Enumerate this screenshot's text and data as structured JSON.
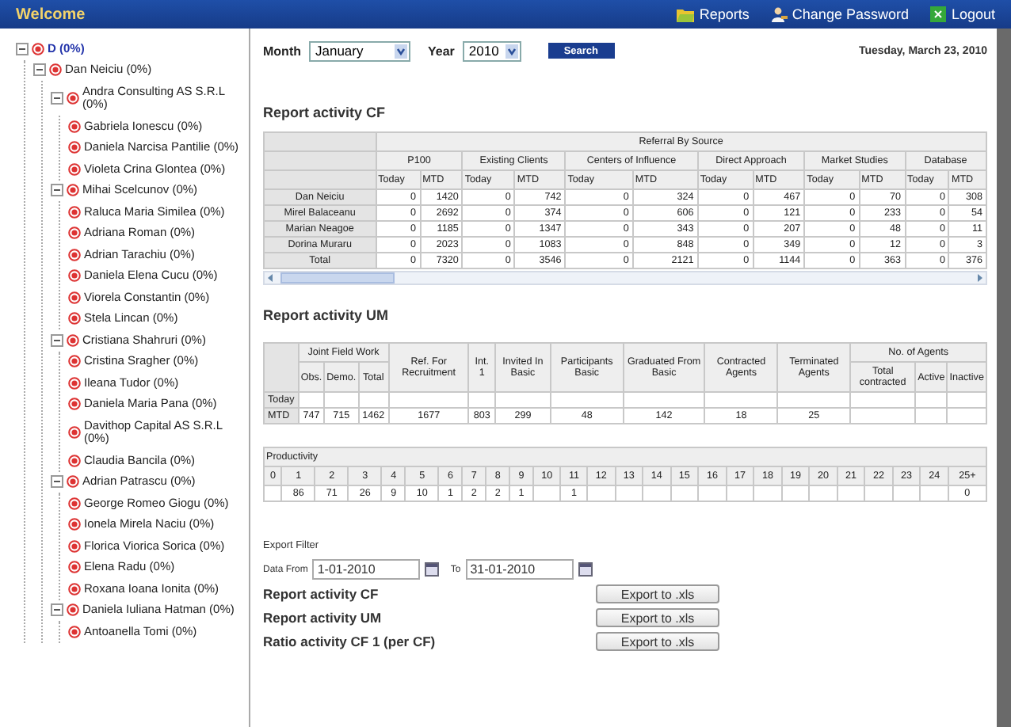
{
  "header": {
    "title": "Welcome",
    "links": [
      {
        "kind": "reports",
        "label": "Reports"
      },
      {
        "kind": "password",
        "label": "Change Password"
      },
      {
        "kind": "logout",
        "label": "Logout"
      }
    ]
  },
  "tree": [
    {
      "label": "D (0%)",
      "expanded": true,
      "children": [
        {
          "label": "Dan Neiciu (0%)",
          "expanded": true,
          "children": [
            {
              "label": "Andra Consulting AS S.R.L (0%)",
              "expanded": true,
              "children": [
                {
                  "label": "Gabriela Ionescu (0%)"
                },
                {
                  "label": "Daniela Narcisa Pantilie (0%)"
                },
                {
                  "label": "Violeta Crina Glontea (0%)"
                }
              ]
            },
            {
              "label": "Mihai Scelcunov (0%)",
              "expanded": true,
              "children": [
                {
                  "label": "Raluca Maria Similea (0%)"
                },
                {
                  "label": "Adriana Roman (0%)"
                },
                {
                  "label": "Adrian Tarachiu (0%)"
                },
                {
                  "label": "Daniela Elena Cucu (0%)"
                },
                {
                  "label": "Viorela Constantin (0%)"
                },
                {
                  "label": "Stela Lincan (0%)"
                }
              ]
            },
            {
              "label": "Cristiana Shahruri (0%)",
              "expanded": true,
              "children": [
                {
                  "label": "Cristina Sragher (0%)"
                },
                {
                  "label": "Ileana Tudor (0%)"
                },
                {
                  "label": "Daniela Maria Pana (0%)"
                },
                {
                  "label": "Davithop Capital AS S.R.L (0%)"
                },
                {
                  "label": "Claudia Bancila (0%)"
                }
              ]
            },
            {
              "label": "Adrian Patrascu (0%)",
              "expanded": true,
              "children": [
                {
                  "label": "George Romeo Giogu (0%)"
                },
                {
                  "label": "Ionela Mirela Naciu (0%)"
                },
                {
                  "label": "Florica Viorica Sorica (0%)"
                },
                {
                  "label": "Elena Radu (0%)"
                },
                {
                  "label": "Roxana Ioana Ionita (0%)"
                }
              ]
            },
            {
              "label": "Daniela Iuliana Hatman (0%)",
              "expanded": true,
              "children": [
                {
                  "label": "Antoanella Tomi (0%)"
                }
              ]
            }
          ]
        }
      ]
    }
  ],
  "filters": {
    "month_label": "Month",
    "month": "January",
    "year_label": "Year",
    "year": "2010",
    "search_button": "Search",
    "date": "Tuesday, March 23, 2010"
  },
  "report_cf": {
    "title": "Report activity CF",
    "group_header": "Referral By Source",
    "columns": [
      {
        "label": "P100",
        "sub_columns": [
          "Today",
          "MTD"
        ]
      },
      {
        "label": "Existing Clients",
        "sub_columns": [
          "Today",
          "MTD"
        ]
      },
      {
        "label": "Centers of Influence",
        "sub_columns": [
          "Today",
          "MTD"
        ]
      },
      {
        "label": "Direct Approach",
        "sub_columns": [
          "Today",
          "MTD"
        ]
      },
      {
        "label": "Market Studies",
        "sub_columns": [
          "Today",
          "MTD"
        ]
      },
      {
        "label": "Database",
        "sub_columns": [
          "Today",
          "MTD"
        ]
      }
    ],
    "rows": [
      {
        "label": "Dan Neiciu",
        "values": [
          "0",
          "1420",
          "0",
          "742",
          "0",
          "324",
          "0",
          "467",
          "0",
          "70",
          "0",
          "308"
        ]
      },
      {
        "label": "Mirel Balaceanu",
        "values": [
          "0",
          "2692",
          "0",
          "374",
          "0",
          "606",
          "0",
          "121",
          "0",
          "233",
          "0",
          "54"
        ]
      },
      {
        "label": "Marian Neagoe",
        "values": [
          "0",
          "1185",
          "0",
          "1347",
          "0",
          "343",
          "0",
          "207",
          "0",
          "48",
          "0",
          "11"
        ]
      },
      {
        "label": "Dorina Muraru",
        "values": [
          "0",
          "2023",
          "0",
          "1083",
          "0",
          "848",
          "0",
          "349",
          "0",
          "12",
          "0",
          "3"
        ]
      },
      {
        "label": "Total",
        "values": [
          "0",
          "7320",
          "0",
          "3546",
          "0",
          "2121",
          "0",
          "1144",
          "0",
          "363",
          "0",
          "376"
        ]
      }
    ]
  },
  "report_um": {
    "title": "Report activity UM",
    "columns": [
      {
        "label": "Joint Field Work",
        "children": [
          "Obs.",
          "Demo.",
          "Total"
        ]
      },
      {
        "label": "Ref. For Recruitment"
      },
      {
        "label": "Int. 1"
      },
      {
        "label": "Invited In Basic"
      },
      {
        "label": "Participants Basic"
      },
      {
        "label": "Graduated From Basic"
      },
      {
        "label": "Contracted Agents"
      },
      {
        "label": "Terminated Agents"
      },
      {
        "label": "No. of Agents",
        "children": [
          "Total contracted",
          "Active",
          "Inactive"
        ]
      }
    ],
    "rows": [
      {
        "label": "Today",
        "values": []
      },
      {
        "label": "MTD",
        "values": [
          "747",
          "715",
          "1462",
          "1677",
          "803",
          "299",
          "48",
          "142",
          "18",
          "25"
        ]
      }
    ]
  },
  "productivity": {
    "title": "Productivity",
    "columns": [
      "0",
      "1",
      "2",
      "3",
      "4",
      "5",
      "6",
      "7",
      "8",
      "9",
      "10",
      "11",
      "12",
      "13",
      "14",
      "15",
      "16",
      "17",
      "18",
      "19",
      "20",
      "21",
      "22",
      "23",
      "24",
      "25+"
    ],
    "values_by_column": {
      "1": "86",
      "2": "71",
      "3": "26",
      "4": "9",
      "5": "10",
      "6": "1",
      "7": "2",
      "8": "2",
      "9": "1",
      "11": "1",
      "25": "0"
    }
  },
  "export": {
    "title": "Export Filter",
    "from_label": "Data From",
    "from": "1-01-2010",
    "to_label": "To",
    "to": "31-01-2010",
    "rows": [
      {
        "label": "Report activity CF",
        "button": "Export to .xls"
      },
      {
        "label": "Report activity UM",
        "button": "Export to .xls"
      },
      {
        "label": "Ratio activity CF 1 (per CF)",
        "button": "Export to .xls"
      }
    ]
  }
}
